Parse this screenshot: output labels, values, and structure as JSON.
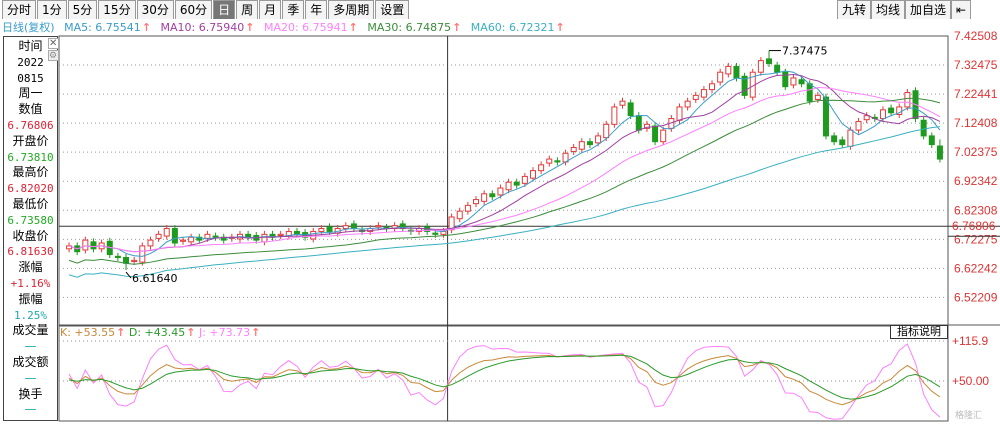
{
  "tabs": [
    "分时",
    "1分",
    "5分",
    "15分",
    "30分",
    "60分",
    "日",
    "周",
    "月",
    "季",
    "年",
    "多周期",
    "设置"
  ],
  "active_tab": "日",
  "right_buttons": [
    "九转",
    "均线",
    "加自选"
  ],
  "ma_line": {
    "title": "日线(复权)",
    "ma5": "MA5: 6.75541",
    "ma10": "MA10: 6.75940",
    "ma20": "MA20: 6.75941",
    "ma30": "MA30: 6.74875",
    "ma60": "MA60: 6.72321",
    "arrow": "↑"
  },
  "colors": {
    "ma5": "#3a9cc8",
    "ma10": "#a040a0",
    "ma20": "#ff7fff",
    "ma30": "#3c8c3c",
    "ma60": "#3ab0c0",
    "up": "#e23a3a",
    "down": "#1e9a1e"
  },
  "info": {
    "time_label": "时间",
    "year": "2022",
    "date": "0815",
    "weekday": "周一",
    "value_label": "数值",
    "value": "6.76806",
    "open_label": "开盘价",
    "open": "6.73810",
    "high_label": "最高价",
    "high": "6.82020",
    "low_label": "最低价",
    "low": "6.73580",
    "close_label": "收盘价",
    "close": "6.81630",
    "change_label": "涨幅",
    "change": "+1.16%",
    "amp_label": "振幅",
    "amp": "1.25%",
    "vol_label": "成交量",
    "vol": "—",
    "amount_label": "成交额",
    "amount": "—",
    "turnover_label": "换手",
    "turnover": "—"
  },
  "kdj": {
    "k": "K: +53.55",
    "d": "D: +43.45",
    "j": "J: +73.73",
    "arrow": "↑"
  },
  "explain_label": "指标说明",
  "watermark": "格隆汇",
  "chart_data": {
    "type": "candlestick",
    "price_axis_labels": [
      "7.42508",
      "7.32475",
      "7.22441",
      "7.12408",
      "7.02375",
      "6.92342",
      "6.82308",
      "6.72275",
      "6.62242",
      "6.52209"
    ],
    "crosshair_value": "6.76806",
    "annotations": {
      "high": "7.37475",
      "low": "6.61640"
    },
    "kdj_axis_labels": [
      "+115.9",
      "+50.00"
    ],
    "closes": [
      6.7,
      6.68,
      6.72,
      6.69,
      6.71,
      6.67,
      6.66,
      6.64,
      6.65,
      6.7,
      6.72,
      6.74,
      6.76,
      6.71,
      6.72,
      6.73,
      6.72,
      6.74,
      6.73,
      6.72,
      6.73,
      6.74,
      6.73,
      6.72,
      6.74,
      6.73,
      6.74,
      6.75,
      6.74,
      6.73,
      6.75,
      6.76,
      6.75,
      6.76,
      6.77,
      6.76,
      6.75,
      6.76,
      6.77,
      6.76,
      6.77,
      6.76,
      6.75,
      6.76,
      6.75,
      6.74,
      6.75,
      6.8,
      6.82,
      6.84,
      6.86,
      6.88,
      6.87,
      6.9,
      6.92,
      6.91,
      6.94,
      6.96,
      6.98,
      7.0,
      6.99,
      7.02,
      7.04,
      7.06,
      7.05,
      7.08,
      7.12,
      7.18,
      7.2,
      7.15,
      7.1,
      7.12,
      7.06,
      7.1,
      7.14,
      7.18,
      7.2,
      7.22,
      7.24,
      7.26,
      7.3,
      7.32,
      7.28,
      7.22,
      7.3,
      7.34,
      7.33,
      7.3,
      7.25,
      7.28,
      7.26,
      7.2,
      7.22,
      7.08,
      7.06,
      7.05,
      7.1,
      7.13,
      7.15,
      7.14,
      7.17,
      7.16,
      7.18,
      7.23,
      7.14,
      7.08,
      7.05,
      7.0
    ]
  }
}
